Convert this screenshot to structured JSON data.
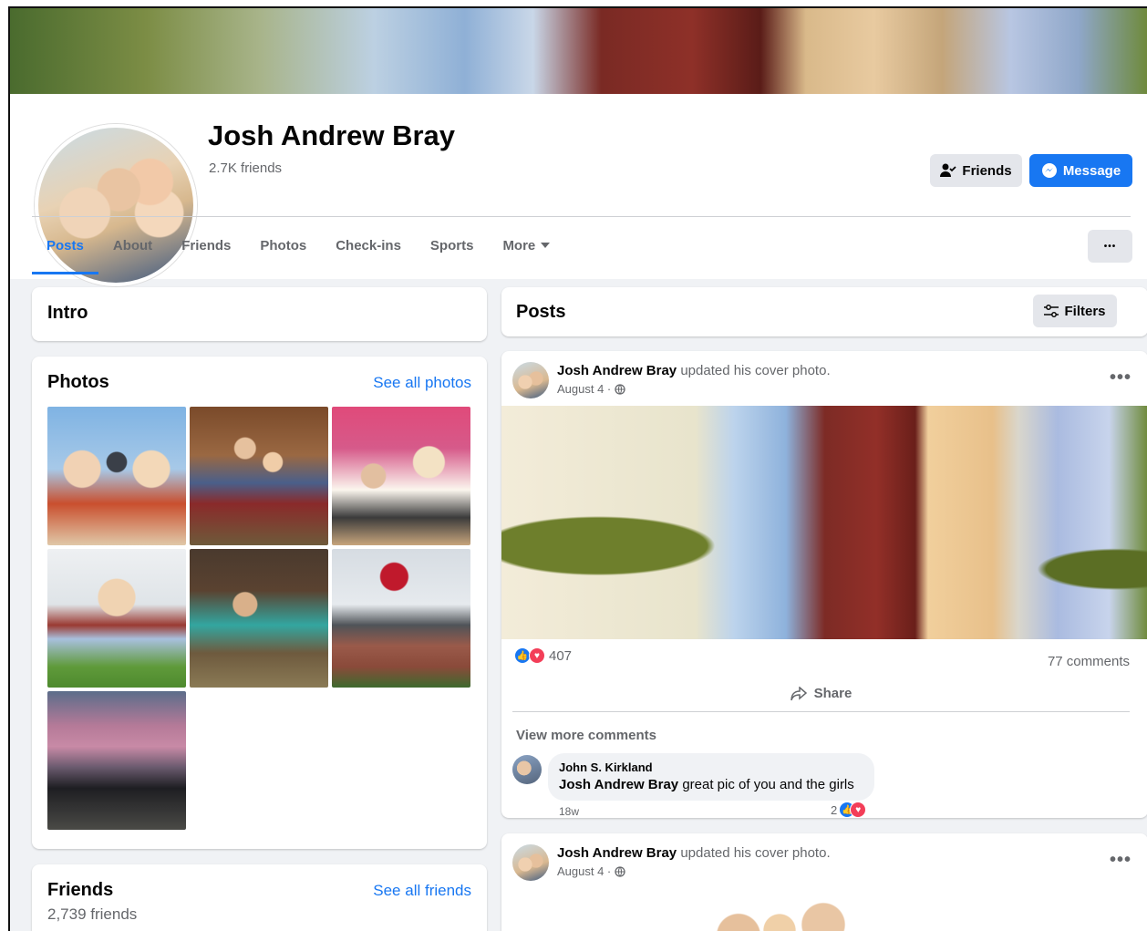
{
  "profile": {
    "name": "Josh Andrew Bray",
    "friend_count": "2.7K friends"
  },
  "actions": {
    "friends_label": "Friends",
    "message_label": "Message",
    "more_dots": "•••"
  },
  "tabs": [
    {
      "label": "Posts",
      "active": true
    },
    {
      "label": "About"
    },
    {
      "label": "Friends"
    },
    {
      "label": "Photos"
    },
    {
      "label": "Check-ins"
    },
    {
      "label": "Sports"
    },
    {
      "label": "More"
    }
  ],
  "intro": {
    "title": "Intro"
  },
  "photos": {
    "title": "Photos",
    "see_all": "See all photos"
  },
  "friends_card": {
    "title": "Friends",
    "see_all": "See all friends",
    "count": "2,739 friends"
  },
  "posts_section": {
    "title": "Posts",
    "filters_label": "Filters"
  },
  "post1": {
    "author": "Josh Andrew Bray",
    "action": "updated his cover photo.",
    "date": "August 4 ·",
    "reaction_count": "407",
    "comments": "77 comments",
    "share_label": "Share",
    "view_more": "View more comments",
    "comment": {
      "name": "John S. Kirkland",
      "tag": "Josh Andrew Bray",
      "text": " great pic of you and the girls",
      "time": "18w",
      "reactions": "2"
    }
  },
  "post2": {
    "author": "Josh Andrew Bray",
    "action": "updated his cover photo.",
    "date": "August 4 ·"
  },
  "colors": {
    "accent": "#1877f2",
    "love": "#f33e58",
    "background": "#f0f2f5"
  }
}
